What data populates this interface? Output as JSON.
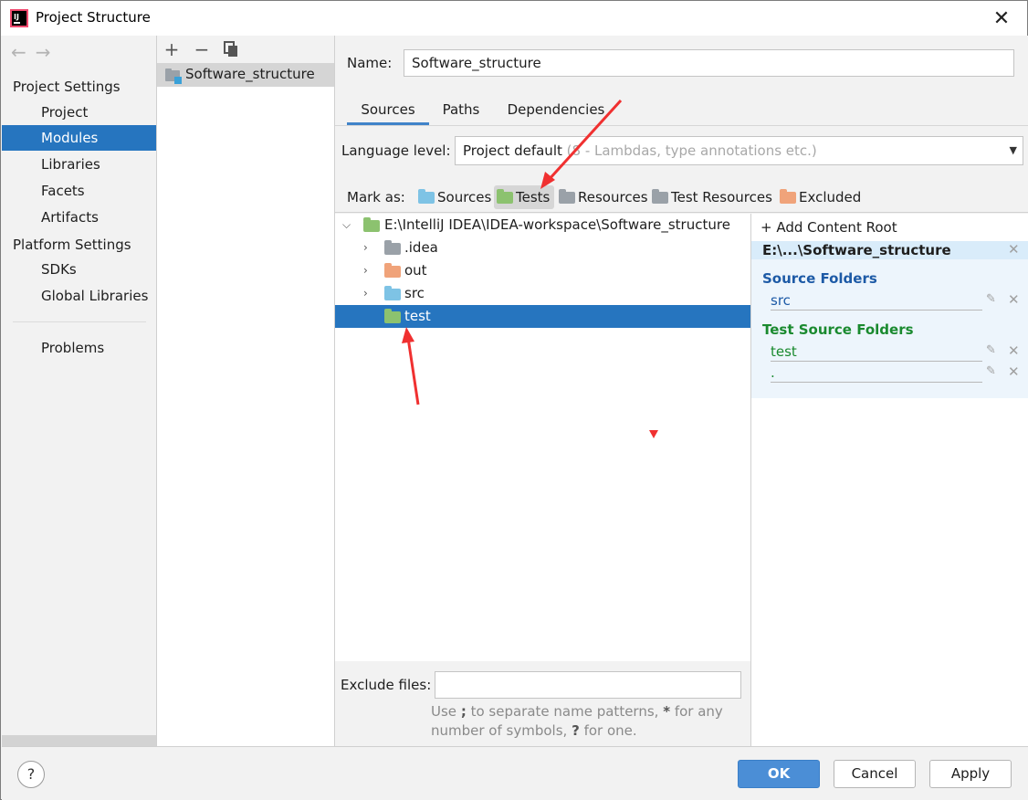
{
  "window": {
    "title": "Project Structure"
  },
  "sidebar": {
    "items": [
      {
        "label": "Project Settings",
        "kind": "group"
      },
      {
        "label": "Project",
        "kind": "sub"
      },
      {
        "label": "Modules",
        "kind": "sub",
        "selected": true
      },
      {
        "label": "Libraries",
        "kind": "sub"
      },
      {
        "label": "Facets",
        "kind": "sub"
      },
      {
        "label": "Artifacts",
        "kind": "sub"
      },
      {
        "label": "Platform Settings",
        "kind": "group"
      },
      {
        "label": "SDKs",
        "kind": "sub"
      },
      {
        "label": "Global Libraries",
        "kind": "sub"
      },
      {
        "label": "Problems",
        "kind": "sub"
      }
    ]
  },
  "modules": {
    "items": [
      {
        "label": "Software_structure"
      }
    ]
  },
  "main": {
    "name_label": "Name:",
    "name_value": "Software_structure",
    "tabs": [
      {
        "label": "Sources"
      },
      {
        "label": "Paths"
      },
      {
        "label": "Dependencies"
      }
    ],
    "language_label": "Language level:",
    "language_value": "Project default",
    "language_hint": "(8 - Lambdas, type annotations etc.)",
    "mark_label": "Mark as:",
    "mark_buttons": [
      {
        "label": "Sources",
        "color": "#7ec3e5"
      },
      {
        "label": "Tests",
        "color": "#8cc26f"
      },
      {
        "label": "Resources",
        "color": "#9aa1a8"
      },
      {
        "label": "Test Resources",
        "color": "#9aa1a8"
      },
      {
        "label": "Excluded",
        "color": "#f0a37a"
      }
    ],
    "tree": {
      "root": "E:\\IntelliJ IDEA\\IDEA-workspace\\Software_structure",
      "children": [
        {
          "label": ".idea",
          "color": "#9aa1a8"
        },
        {
          "label": "out",
          "color": "#f0a37a"
        },
        {
          "label": "src",
          "color": "#7ec3e5"
        },
        {
          "label": "test",
          "color": "#8cc26f"
        }
      ]
    },
    "exclude_label": "Exclude files:",
    "exclude_value": "",
    "exclude_help_1": "Use",
    "exclude_help_sep": ";",
    "exclude_help_2": "to separate name patterns,",
    "exclude_help_star": "*",
    "exclude_help_3": "for any number of symbols,",
    "exclude_help_q": "?",
    "exclude_help_4": "for one."
  },
  "roots": {
    "add_label": "Add Content Root",
    "root_path": "E:\\...\\Software_structure",
    "source_title": "Source Folders",
    "source_title_color": "#1d5aa6",
    "source_entries": [
      "src"
    ],
    "test_title": "Test Source Folders",
    "test_title_color": "#1a8a2f",
    "test_entries": [
      "test",
      "."
    ]
  },
  "footer": {
    "help": "?",
    "ok": "OK",
    "cancel": "Cancel",
    "apply": "Apply"
  }
}
